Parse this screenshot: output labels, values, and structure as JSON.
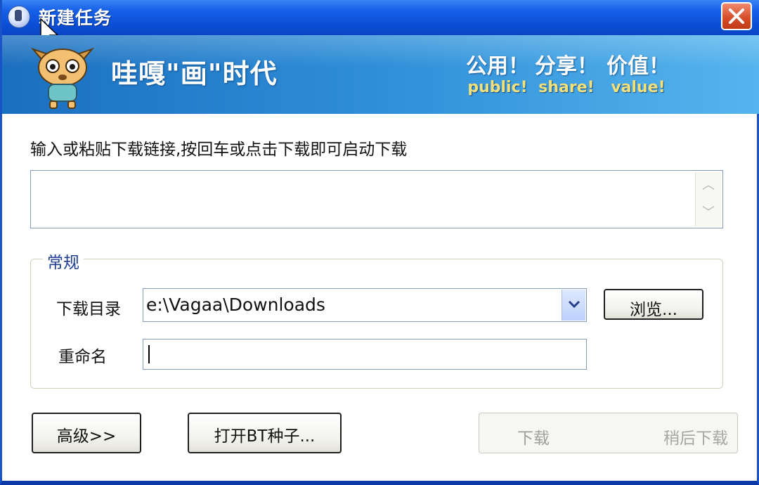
{
  "window": {
    "title": "新建任务"
  },
  "banner": {
    "slogan": "哇嘎\"画\"时代",
    "mottos": [
      {
        "cn": "公用！",
        "en": "public!"
      },
      {
        "cn": "分享！",
        "en": "share!"
      },
      {
        "cn": "价值！",
        "en": "value!"
      }
    ]
  },
  "instruction": "输入或粘贴下载链接,按回车或点击下载即可启动下载",
  "url_input": {
    "value": ""
  },
  "general_group": {
    "title": "常规",
    "download_dir_label": "下载目录",
    "download_dir_value": "e:\\Vagaa\\Downloads",
    "browse_label": "浏览...",
    "rename_label": "重命名",
    "rename_value": ""
  },
  "buttons": {
    "advanced": "高级>>",
    "open_torrent": "打开BT种子...",
    "download": "下载",
    "download_later": "稍后下载"
  },
  "colors": {
    "titlebar": "#0b4fd6",
    "banner": "#2f8fd8",
    "motto_en": "#f4e07a",
    "group_title": "#1e3d93"
  }
}
